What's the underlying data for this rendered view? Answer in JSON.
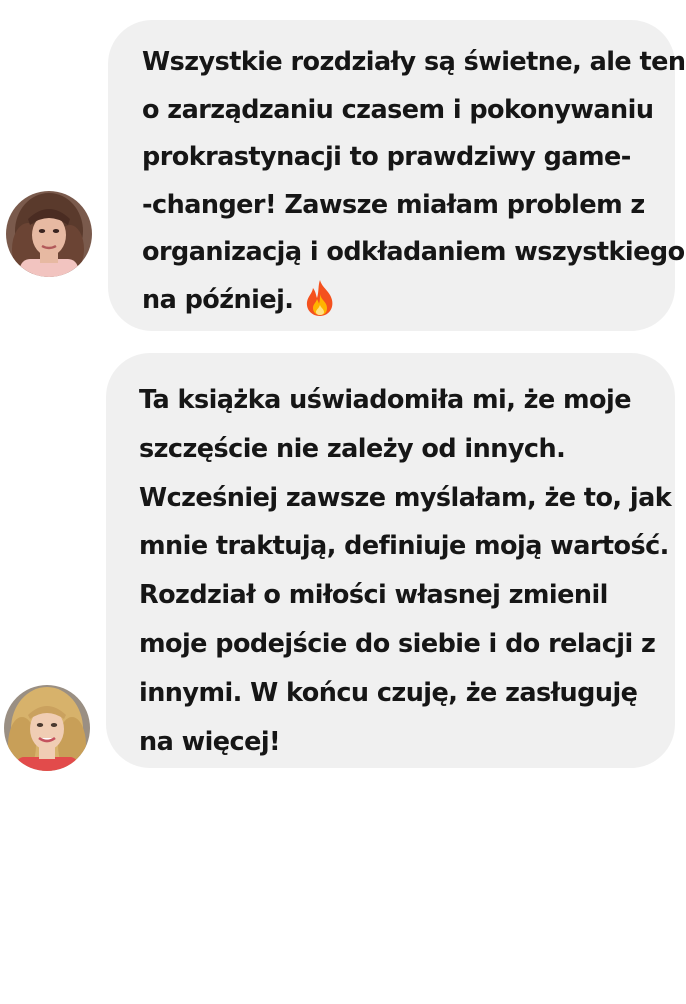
{
  "messages": [
    {
      "avatar_icon": "user-photo-icon",
      "lines": [
        "Wszystkie rozdziały są świetne, ale ten",
        "o zarządzaniu czasem i pokonywaniu",
        "prokrastynacji to prawdziwy game-",
        "-changer! Zawsze miałam problem z",
        "organizacją i odkładaniem wszystkiego",
        "na później."
      ],
      "emoji_icon": "fire-emoji-icon"
    },
    {
      "avatar_icon": "user-photo-icon",
      "lines": [
        "Ta książka uświadomiła mi, że moje",
        "szczęście nie zależy od innych.",
        "Wcześniej zawsze myślałam, że to, jak",
        "mnie traktują, definiuje moją wartość.",
        "Rozdział o miłości własnej zmienil",
        "moje podejście do siebie i do relacji z",
        "innymi. W końcu czuję, że zasługuję",
        "na więcej!"
      ]
    }
  ],
  "colors": {
    "background": "#ffffff",
    "bubble": "#f0f0f0",
    "text": "#161616"
  }
}
